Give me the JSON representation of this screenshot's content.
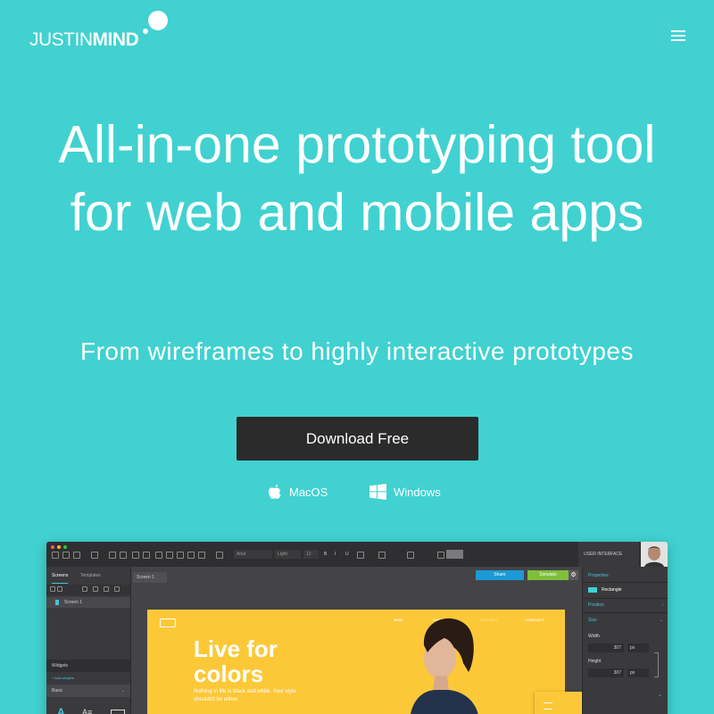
{
  "brand": {
    "logo_thin": "JUSTIN",
    "logo_bold": "MIND"
  },
  "hero": {
    "title": "All-in-one prototyping tool for web and mobile apps",
    "subtitle": "From wireframes to highly interactive prototypes",
    "download_label": "Download Free",
    "os_mac_label": "MacOS",
    "os_windows_label": "Windows"
  },
  "app": {
    "toolbar": {
      "font_field": "Arial",
      "weight_field": "Light",
      "size_field": "12",
      "style_b": "B",
      "style_i": "I",
      "style_u": "U",
      "user_interface_label": "USER INTERFACE"
    },
    "left_panel": {
      "tab_screens": "Screens",
      "tab_templates": "Templates",
      "screen_1": "Screen 1",
      "widgets_label": "Widgets",
      "add_widgets": "+ Add widgets",
      "basic_label": "Basic"
    },
    "canvas": {
      "screen_tab": "Screen 1",
      "share_label": "Share",
      "simulate_label": "Simulate",
      "design": {
        "nav": [
          "NEW",
          "OVERVIEW",
          "GALLERY",
          "CONTACT"
        ],
        "title": "Live for colors",
        "body": "Nothing in life is black and white. Your style shouldn't be either."
      }
    },
    "right_panel": {
      "properties_label": "Properties",
      "element_label": "Rectangle",
      "position_label": "Position",
      "size_label": "Size",
      "width_label": "Width",
      "width_value": "307",
      "width_unit": "px",
      "height_label": "Height",
      "height_value": "307",
      "height_unit": "px"
    }
  },
  "colors": {
    "background": "#41d1d1",
    "button_dark": "#2b2b2b",
    "share_blue": "#1b9ad6",
    "simulate_green": "#7fbf3a",
    "design_yellow": "#fcc838",
    "accent_teal": "#47c2d8"
  }
}
